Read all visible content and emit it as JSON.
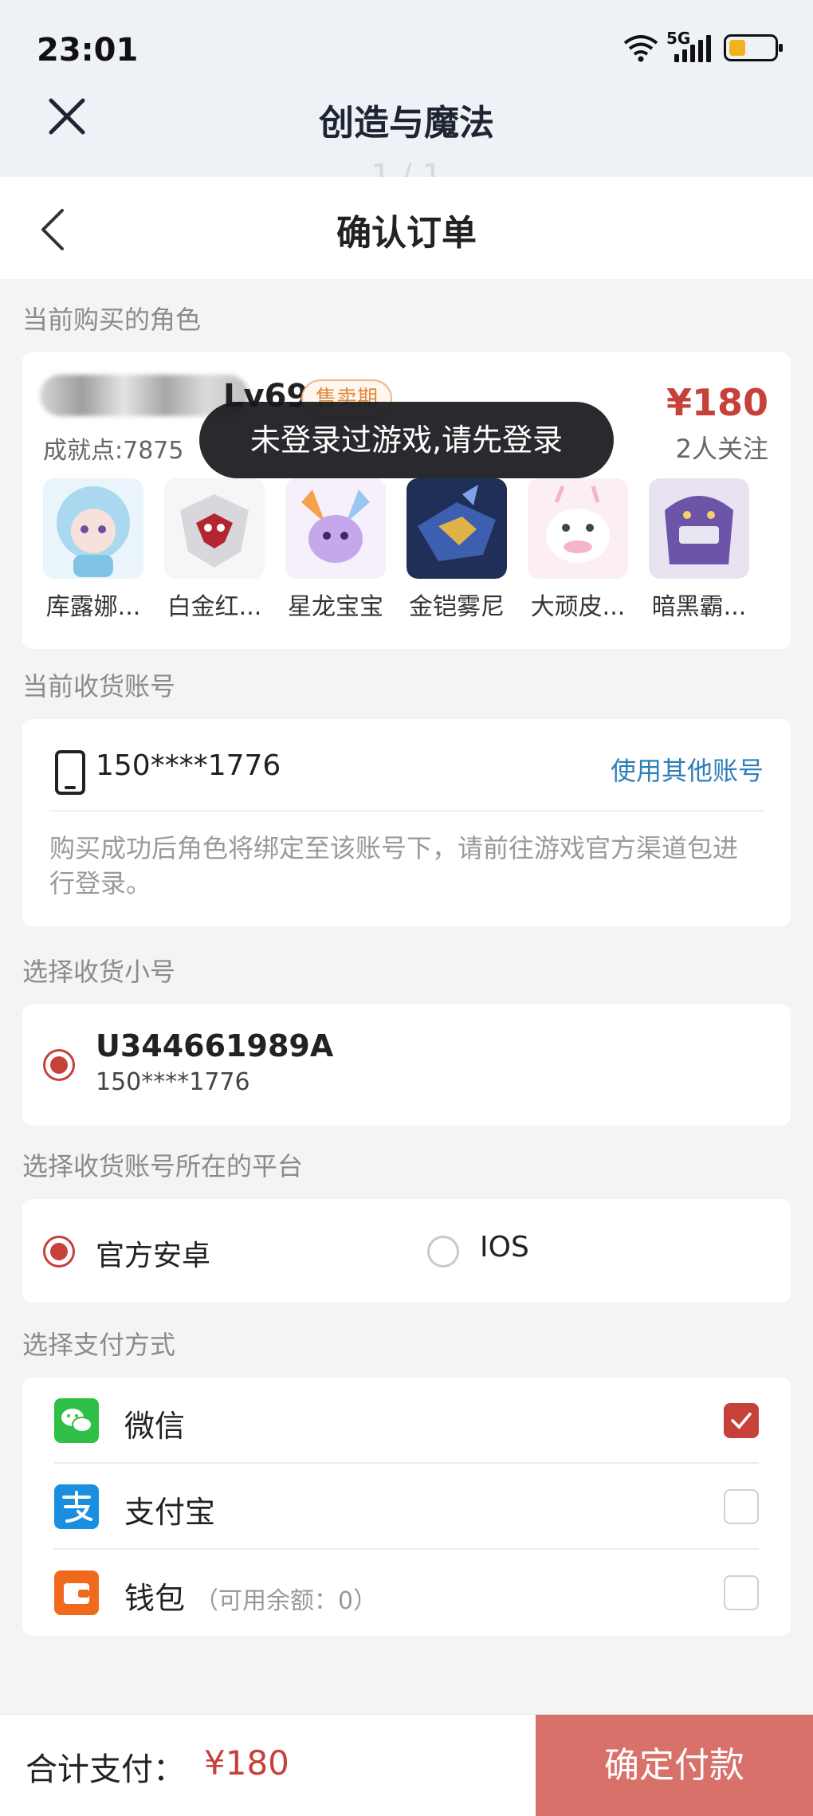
{
  "status_bar": {
    "time": "23:01",
    "network": "5G"
  },
  "app": {
    "title": "创造与魔法",
    "page_indicator": "1 / 1"
  },
  "nav": {
    "title": "确认订单"
  },
  "sections": {
    "role": "当前购买的角色",
    "account": "当前收货账号",
    "sub_account": "选择收货小号",
    "platform": "选择收货账号所在的平台",
    "payment": "选择支付方式"
  },
  "role": {
    "level": "Lv69",
    "badge": "售卖期",
    "achievement": "成就点:7875",
    "price": "¥180",
    "followers": "2人关注",
    "pets": [
      {
        "name": "库露娜...",
        "icon": "pet-kuluna-icon"
      },
      {
        "name": "白金红...",
        "icon": "pet-platinum-red-icon"
      },
      {
        "name": "星龙宝宝",
        "icon": "pet-star-dragon-icon"
      },
      {
        "name": "金铠雾尼",
        "icon": "pet-gold-armor-icon"
      },
      {
        "name": "大顽皮...",
        "icon": "pet-big-naughty-icon"
      },
      {
        "name": "暗黑霸...",
        "icon": "pet-dark-overlord-icon"
      }
    ]
  },
  "toast": "未登录过游戏,请先登录",
  "account": {
    "number": "150****1776",
    "other_link": "使用其他账号",
    "note": "购买成功后角色将绑定至该账号下，请前往游戏官方渠道包进行登录。"
  },
  "sub_account": {
    "id": "U344661989A",
    "phone": "150****1776",
    "selected": true
  },
  "platform": {
    "options": [
      {
        "label": "官方安卓",
        "selected": true
      },
      {
        "label": "IOS",
        "selected": false
      }
    ]
  },
  "payment": {
    "methods": [
      {
        "label": "微信",
        "icon": "wechat-icon",
        "checked": true,
        "color": "#2fbf47"
      },
      {
        "label": "支付宝",
        "icon": "alipay-icon",
        "checked": false,
        "color": "#1a8fe0"
      },
      {
        "label": "钱包",
        "icon": "wallet-icon",
        "checked": false,
        "color": "#f06a1e",
        "balance": "（可用余额：0）"
      }
    ]
  },
  "footer": {
    "total_label": "合计支付：",
    "total_value": "¥180",
    "confirm": "确定付款"
  },
  "colors": {
    "accent": "#c7413b",
    "confirm_bg": "#d8716a",
    "link": "#2d7fb7"
  }
}
